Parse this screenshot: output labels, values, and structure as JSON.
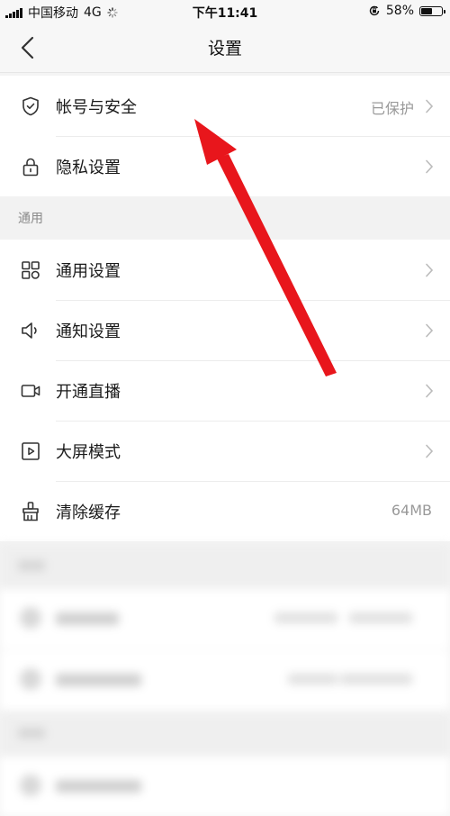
{
  "status_bar": {
    "carrier": "中国移动",
    "network": "4G",
    "time": "下午11:41",
    "battery": "58%",
    "battery_level": 0.58
  },
  "nav": {
    "title": "设置"
  },
  "security_group": {
    "items": [
      {
        "label": "帐号与安全",
        "value": "已保护",
        "icon": "shield-check-icon"
      },
      {
        "label": "隐私设置",
        "value": "",
        "icon": "lock-icon"
      }
    ]
  },
  "general_section": {
    "header": "通用",
    "items": [
      {
        "label": "通用设置",
        "icon": "grid-icon"
      },
      {
        "label": "通知设置",
        "icon": "speaker-icon"
      },
      {
        "label": "开通直播",
        "icon": "video-camera-icon"
      },
      {
        "label": "大屏模式",
        "icon": "play-screen-icon"
      },
      {
        "label": "清除缓存",
        "value": "64MB",
        "icon": "broom-icon"
      }
    ]
  },
  "annotation": {
    "color": "#e8161c"
  }
}
